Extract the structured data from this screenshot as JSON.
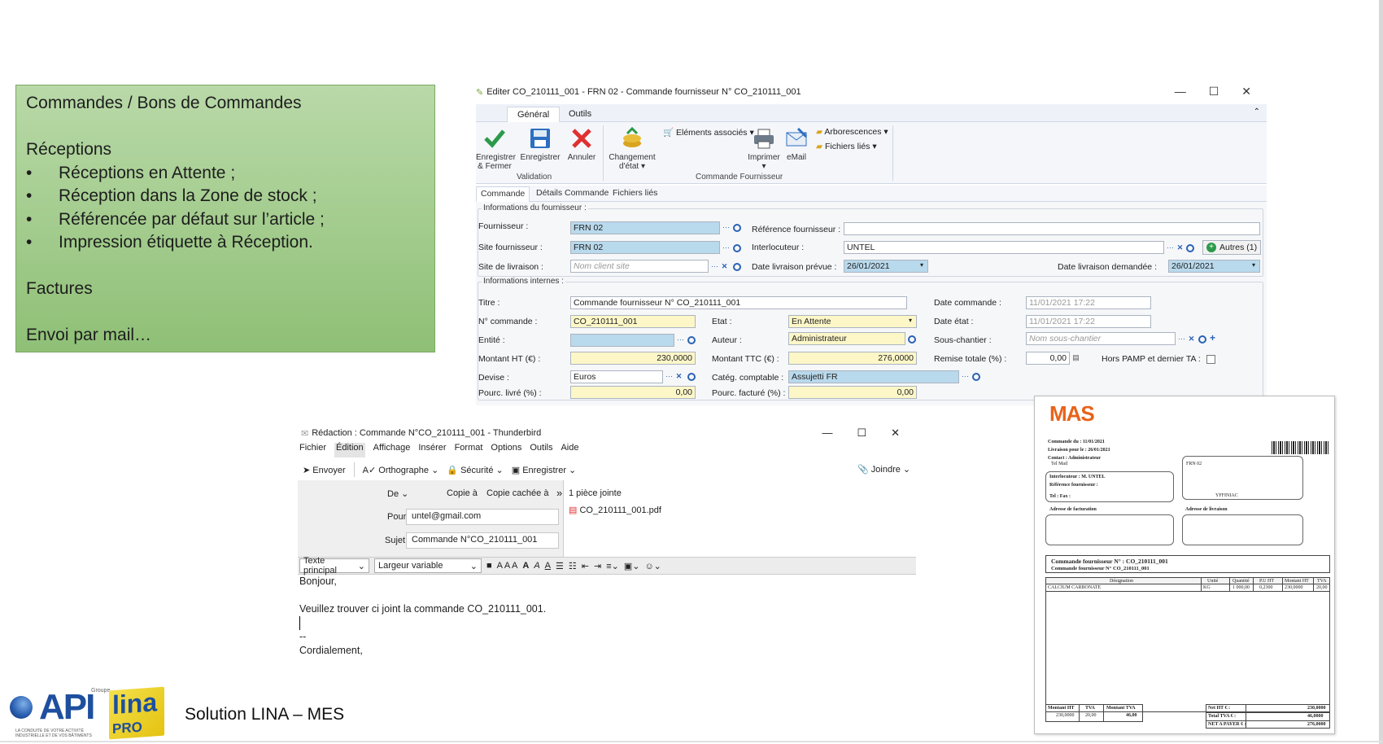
{
  "note": {
    "title": "Commandes / Bons de Commandes",
    "section1": "Réceptions",
    "bullets": [
      "Réceptions en Attente ;",
      "Réception dans la Zone de stock ;",
      "Référencée par défaut sur l’article ;",
      "Impression étiquette à Réception."
    ],
    "bullet_char": "•",
    "section2": "Factures",
    "section3": "Envoi par mail…"
  },
  "erp": {
    "title": "Editer CO_210111_001 - FRN 02 - Commande fournisseur N° CO_210111_001",
    "tabs": [
      "Général",
      "Outils"
    ],
    "buttons": {
      "save_close": "Enregistrer & Fermer",
      "save": "Enregistrer",
      "cancel": "Annuler",
      "change_state": "Changement d'état",
      "print": "Imprimer",
      "email": "eMail",
      "associated": "Eléments associés",
      "trees": "Arborescences",
      "linked_files": "Fichiers liés"
    },
    "groups": {
      "validation": "Validation",
      "order": "Commande Fournisseur"
    },
    "subtabs": [
      "Commande",
      "Détails Commande",
      "Fichiers liés"
    ],
    "supplier_section": "Informations du fournisseur :",
    "internal_section": "Informations internes :",
    "labels": {
      "fournisseur": "Fournisseur :",
      "site_fournisseur": "Site fournisseur :",
      "site_livraison": "Site de livraison :",
      "ref_fournisseur": "Référence fournisseur :",
      "interlocuteur": "Interlocuteur :",
      "date_livraison_prevue": "Date livraison prévue :",
      "date_livraison_demandee": "Date livraison demandée :",
      "titre": "Titre :",
      "n_commande": "N° commande :",
      "entite": "Entité :",
      "montant_ht": "Montant HT (€) :",
      "devise": "Devise :",
      "pourc_livre": "Pourc. livré (%) :",
      "etat": "Etat :",
      "auteur": "Auteur :",
      "montant_ttc": "Montant TTC (€) :",
      "categ_comptable": "Catég. comptable :",
      "pourc_facture": "Pourc. facturé (%) :",
      "date_commande": "Date commande :",
      "date_etat": "Date état :",
      "sous_chantier": "Sous-chantier :",
      "remise_totale": "Remise totale (%) :",
      "hors_pamp": "Hors PAMP et dernier TA :"
    },
    "values": {
      "fournisseur": "FRN 02",
      "site_fournisseur": "FRN 02",
      "site_livraison_ph": "Nom client site",
      "ref_fournisseur": "",
      "interlocuteur": "UNTEL",
      "autres": "Autres (1)",
      "date_livraison_prevue": "26/01/2021",
      "date_livraison_demandee": "26/01/2021",
      "titre": "Commande fournisseur N° CO_210111_001",
      "n_commande": "CO_210111_001",
      "entite": "",
      "montant_ht": "230,0000",
      "devise": "Euros",
      "pourc_livre": "0,00",
      "etat": "En Attente",
      "auteur": "Administrateur",
      "montant_ttc": "276,0000",
      "categ_comptable": "Assujetti FR",
      "pourc_facture": "0,00",
      "date_commande": "11/01/2021 17:22",
      "date_etat": "11/01/2021 17:22",
      "sous_chantier_ph": "Nom sous-chantier",
      "remise_totale": "0,00"
    }
  },
  "thunderbird": {
    "title": "Rédaction : Commande N°CO_210111_001 - Thunderbird",
    "menu": [
      "Fichier",
      "Édition",
      "Affichage",
      "Insérer",
      "Format",
      "Options",
      "Outils",
      "Aide"
    ],
    "toolbar": {
      "send": "Envoyer",
      "spell": "Orthographe",
      "security": "Sécurité",
      "save": "Enregistrer",
      "attach": "Joindre"
    },
    "header": {
      "from": "De",
      "cc": "Copie à",
      "bcc": "Copie cachée à",
      "to_label": "Pour",
      "to_value": "untel@gmail.com",
      "subject_label": "Sujet",
      "subject_value": "Commande N°CO_210111_001",
      "attachments": "1 pièce jointe",
      "attachment_file": "CO_210111_001.pdf"
    },
    "format": {
      "style": "Texte principal",
      "font": "Largeur variable"
    },
    "body": [
      "Bonjour,",
      "",
      "Veuillez trouver ci joint la commande CO_210111_001.",
      "",
      "--",
      "Cordialement,"
    ]
  },
  "invoice": {
    "logo": "MAS",
    "commande_du_label": "Commande du :",
    "commande_du": "11/01/2021",
    "livraison_label": "Livraison pour le :",
    "livraison": "26/01/2021",
    "contact_label": "Contact :",
    "contact": "Administrateur",
    "tel_mail": "Tel     Mail",
    "frn": "FRN 02",
    "yffiniac": "YFFINIAC",
    "interlocuteur": "Interlocuteur :  M. UNTEL",
    "ref_fournisseur": "Référence fournisseur :",
    "tel_fax": "Tel :                              Fax :",
    "adr_fact": "Adresse de facturation",
    "adr_liv": "Adresse de livraison",
    "cmd_title1": "Commande fournisseur N° :  CO_210111_001",
    "cmd_title2": "Commande fournisseur N° CO_210111_001",
    "table_headers": [
      "Désignation",
      "Unité",
      "Quantité",
      "P.U HT",
      "Montant HT",
      "TVA"
    ],
    "table_row": [
      "CALCIUM CARBONATE",
      "KG",
      "1 000,00",
      "0,2300",
      "230,0000",
      "20,00"
    ],
    "totals_headers": [
      "Montant HT",
      "TVA",
      "Montant TVA"
    ],
    "totals_row": [
      "230,0000",
      "20,00",
      "46,00"
    ],
    "net_ht": "Net HT € :",
    "net_ht_v": "230,0000",
    "total_tva": "Total TVA € :",
    "total_tva_v": "46,0000",
    "net_payer": "NET A PAYER € :",
    "net_payer_v": "276,0000"
  },
  "footer": {
    "groupe": "Groupe",
    "api": "API",
    "api_sub": "LA CONDUITE DE VOTRE ACTIVITÉ INDUSTRIELLE ET DE VOS BÂTIMENTS",
    "lina": "lina",
    "pro": "PRO",
    "solution": "Solution LINA – MES"
  }
}
